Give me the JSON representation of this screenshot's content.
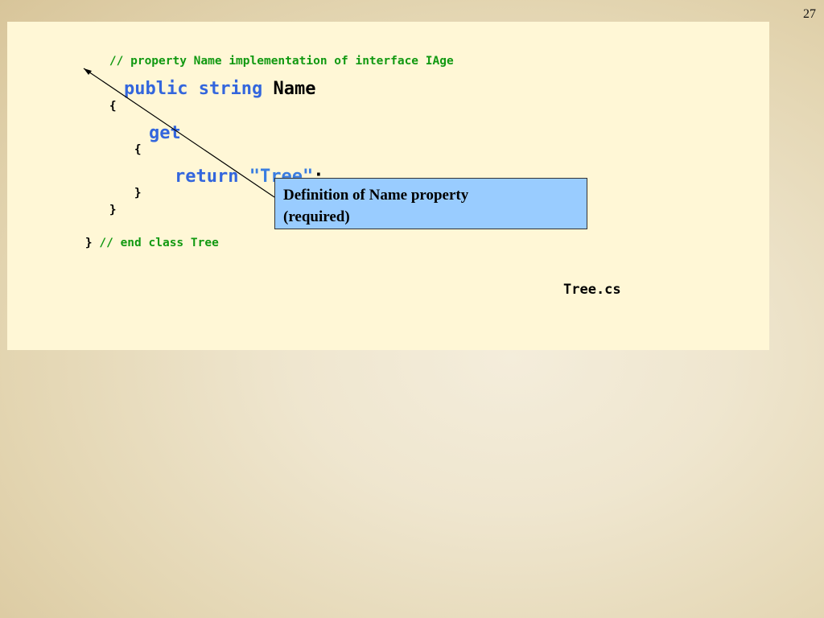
{
  "slide": {
    "number": "27"
  },
  "code": {
    "comment_property": "// property Name implementation of interface IAge",
    "kw_public": "public",
    "kw_string": "string",
    "ident_name": "Name",
    "open_brace_outer": "{",
    "kw_get": "get",
    "open_brace_inner": "{",
    "kw_return": "return",
    "str_tree": "\"Tree\"",
    "semicolon": ";",
    "close_brace_inner": "}",
    "close_brace_outer": "}",
    "close_brace_class": "}",
    "comment_end_class": "// end class Tree"
  },
  "callout": {
    "line1": "Definition of Name property",
    "line2": "(required)"
  },
  "file": {
    "name": "Tree.cs"
  },
  "colors": {
    "comment": "#119911",
    "keyword": "#3366dd",
    "string": "#3a7de0",
    "panel": "#fff7d6",
    "callout_fill": "#99ccff"
  }
}
